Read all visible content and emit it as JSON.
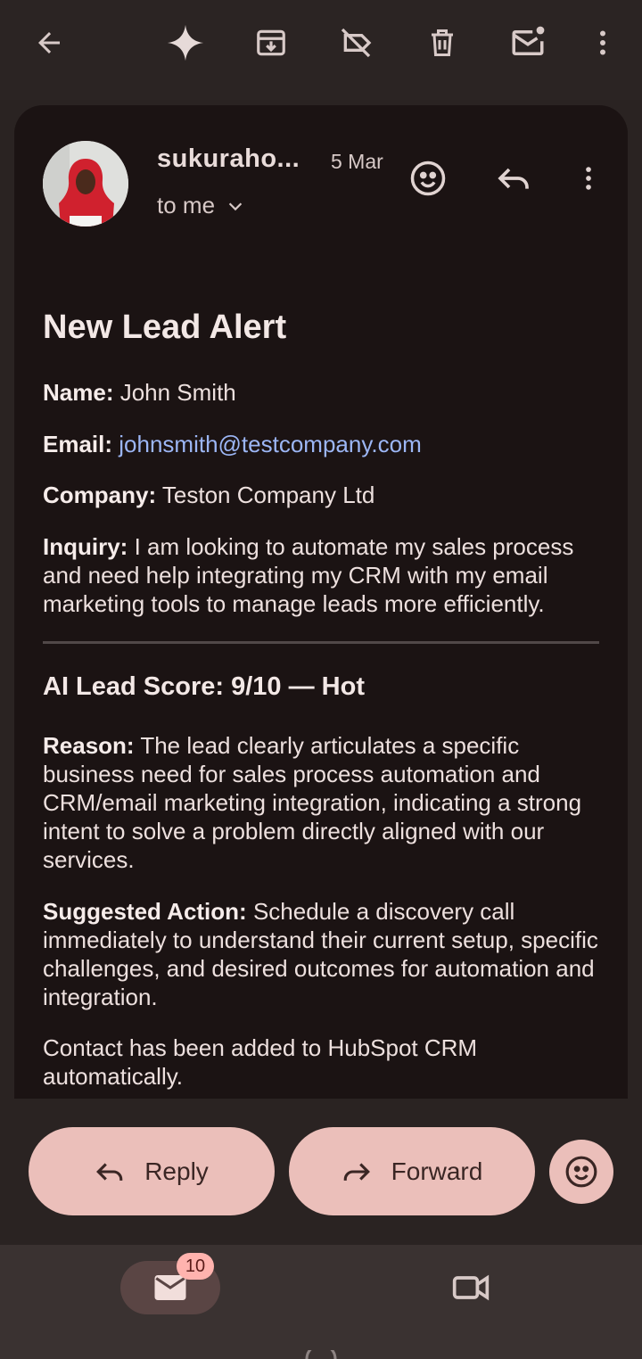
{
  "toolbar": {
    "icons": [
      "back-arrow-icon",
      "gemini-sparkle-icon",
      "archive-icon",
      "label-off-icon",
      "delete-icon",
      "mark-unread-icon",
      "more-vert-icon"
    ]
  },
  "email": {
    "sender": "sukuraho...",
    "date": "5 Mar",
    "recipient": "to me",
    "title": "New Lead Alert",
    "fields": {
      "name_label": "Name:",
      "name_value": " John Smith",
      "email_label": "Email:",
      "email_value": "johnsmith@testcompany.com",
      "company_label": "Company:",
      "company_value": " Teston Company Ltd",
      "inquiry_label": "Inquiry:",
      "inquiry_value": " I am looking to automate my sales process and need help integrating my CRM with my email marketing tools to manage leads more efficiently."
    },
    "score_heading": "AI Lead Score: 9/10 — Hot",
    "reason_label": "Reason:",
    "reason_value": " The lead clearly articulates a specific business need for sales process automation and CRM/email marketing integration, indicating a strong intent to solve a problem directly aligned with our services.",
    "action_label": "Suggested Action:",
    "action_value": " Schedule a discovery call immediately to understand their current setup, specific challenges, and desired outcomes for automation and integration.",
    "footer_note": "Contact has been added to HubSpot CRM automatically."
  },
  "actions": {
    "reply_label": "Reply",
    "forward_label": "Forward"
  },
  "nav": {
    "mail_badge": "10"
  },
  "colors": {
    "accent": "#ebbfba",
    "link": "#9cb6f5",
    "card_bg": "#1b1313",
    "page_bg": "#2a2322"
  }
}
